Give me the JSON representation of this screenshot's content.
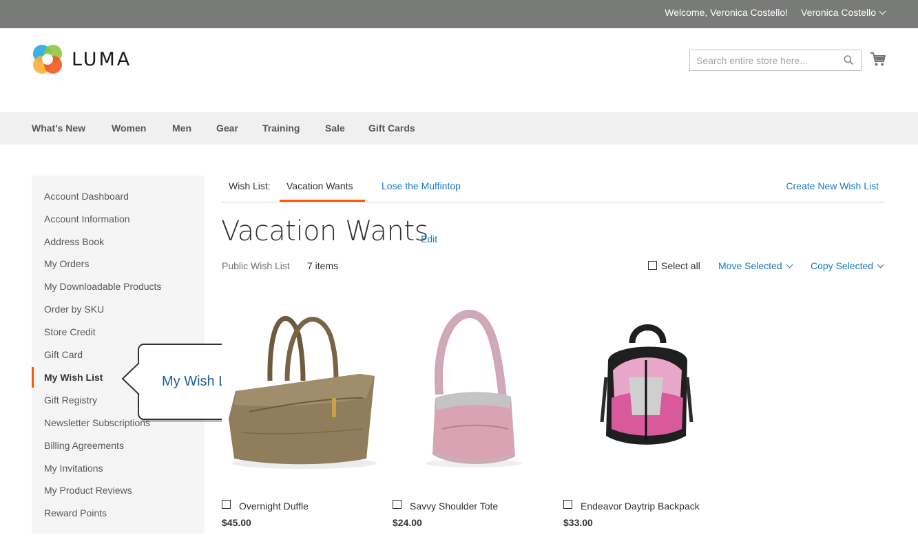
{
  "topbar": {
    "welcome": "Welcome, Veronica Costello!",
    "account_name": "Veronica Costello"
  },
  "header": {
    "logo_text": "LUMA",
    "search_placeholder": "Search entire store here...",
    "search_value": ""
  },
  "nav": {
    "items": [
      "What's New",
      "Women",
      "Men",
      "Gear",
      "Training",
      "Sale",
      "Gift Cards"
    ]
  },
  "sidebar": {
    "items": [
      {
        "label": "Account Dashboard",
        "active": false
      },
      {
        "label": "Account Information",
        "active": false
      },
      {
        "label": "Address Book",
        "active": false
      },
      {
        "label": "My Orders",
        "active": false
      },
      {
        "label": "My Downloadable Products",
        "active": false
      },
      {
        "label": "Order by SKU",
        "active": false
      },
      {
        "label": "Store Credit",
        "active": false
      },
      {
        "label": "Gift Card",
        "active": false
      },
      {
        "label": "My Wish List",
        "active": true
      },
      {
        "label": "Gift Registry",
        "active": false
      },
      {
        "label": "Newsletter Subscriptions",
        "active": false
      },
      {
        "label": "Billing Agreements",
        "active": false
      },
      {
        "label": "My Invitations",
        "active": false
      },
      {
        "label": "My Product Reviews",
        "active": false
      },
      {
        "label": "Reward Points",
        "active": false
      }
    ]
  },
  "callout": {
    "text": "My Wish List"
  },
  "wishlist": {
    "tabs_label": "Wish List:",
    "active_tab": "Vacation Wants",
    "other_tab": "Lose the Muffintop",
    "create_link": "Create New Wish List",
    "title": "Vacation Wants",
    "edit_label": "Edit",
    "visibility": "Public Wish List",
    "item_count": "7 items",
    "select_all": "Select all",
    "move_selected": "Move Selected",
    "copy_selected": "Copy Selected"
  },
  "products": [
    {
      "name": "Overnight Duffle",
      "price": "$45.00",
      "image": "duffle-bag-photo"
    },
    {
      "name": "Savvy Shoulder Tote",
      "price": "$24.00",
      "image": "shoulder-tote-photo"
    },
    {
      "name": "Endeavor Daytrip Backpack",
      "price": "$33.00",
      "image": "backpack-photo"
    }
  ],
  "colors": {
    "accent_orange": "#ff5501",
    "link_blue": "#1979c3",
    "topbar_gray": "#797b78",
    "nav_bg": "#f0f0f0",
    "sidebar_bg": "#f5f5f5"
  }
}
